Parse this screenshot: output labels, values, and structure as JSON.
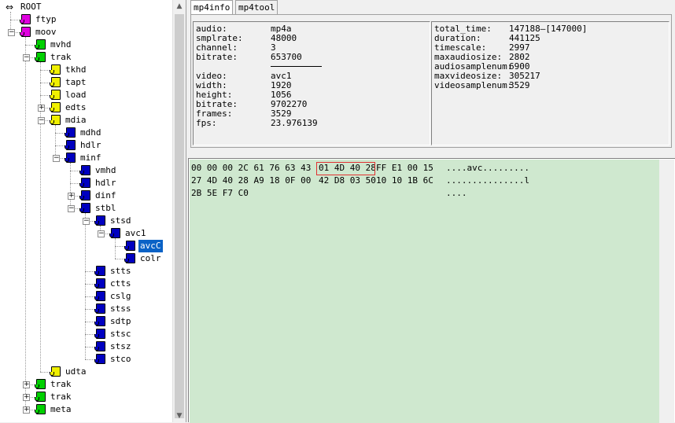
{
  "tree": {
    "nodes": [
      {
        "label": "ROOT",
        "depth": 0,
        "color": "root",
        "exp": ""
      },
      {
        "label": "ftyp",
        "depth": 1,
        "color": "#e000e0",
        "exp": ""
      },
      {
        "label": "moov",
        "depth": 1,
        "color": "#e000e0",
        "exp": "-"
      },
      {
        "label": "mvhd",
        "depth": 2,
        "color": "#00d000",
        "exp": ""
      },
      {
        "label": "trak",
        "depth": 2,
        "color": "#00d000",
        "exp": "-"
      },
      {
        "label": "tkhd",
        "depth": 3,
        "color": "#f0f000",
        "exp": ""
      },
      {
        "label": "tapt",
        "depth": 3,
        "color": "#f0f000",
        "exp": ""
      },
      {
        "label": "load",
        "depth": 3,
        "color": "#f0f000",
        "exp": ""
      },
      {
        "label": "edts",
        "depth": 3,
        "color": "#f0f000",
        "exp": "+"
      },
      {
        "label": "mdia",
        "depth": 3,
        "color": "#f0f000",
        "exp": "-"
      },
      {
        "label": "mdhd",
        "depth": 4,
        "color": "#0000c0",
        "exp": ""
      },
      {
        "label": "hdlr",
        "depth": 4,
        "color": "#0000c0",
        "exp": ""
      },
      {
        "label": "minf",
        "depth": 4,
        "color": "#0000c0",
        "exp": "-"
      },
      {
        "label": "vmhd",
        "depth": 5,
        "color": "#0000c0",
        "exp": ""
      },
      {
        "label": "hdlr",
        "depth": 5,
        "color": "#0000c0",
        "exp": ""
      },
      {
        "label": "dinf",
        "depth": 5,
        "color": "#0000c0",
        "exp": "+"
      },
      {
        "label": "stbl",
        "depth": 5,
        "color": "#0000c0",
        "exp": "-"
      },
      {
        "label": "stsd",
        "depth": 6,
        "color": "#0000c0",
        "exp": "-"
      },
      {
        "label": "avc1",
        "depth": 7,
        "color": "#0000c0",
        "exp": "-"
      },
      {
        "label": "avcC",
        "depth": 8,
        "color": "#0000c0",
        "exp": "",
        "selected": true
      },
      {
        "label": "colr",
        "depth": 8,
        "color": "#0000c0",
        "exp": ""
      },
      {
        "label": "stts",
        "depth": 6,
        "color": "#0000c0",
        "exp": ""
      },
      {
        "label": "ctts",
        "depth": 6,
        "color": "#0000c0",
        "exp": ""
      },
      {
        "label": "cslg",
        "depth": 6,
        "color": "#0000c0",
        "exp": ""
      },
      {
        "label": "stss",
        "depth": 6,
        "color": "#0000c0",
        "exp": ""
      },
      {
        "label": "sdtp",
        "depth": 6,
        "color": "#0000c0",
        "exp": ""
      },
      {
        "label": "stsc",
        "depth": 6,
        "color": "#0000c0",
        "exp": ""
      },
      {
        "label": "stsz",
        "depth": 6,
        "color": "#0000c0",
        "exp": ""
      },
      {
        "label": "stco",
        "depth": 6,
        "color": "#0000c0",
        "exp": ""
      },
      {
        "label": "udta",
        "depth": 3,
        "color": "#f0f000",
        "exp": ""
      },
      {
        "label": "trak",
        "depth": 2,
        "color": "#00d000",
        "exp": "+"
      },
      {
        "label": "trak",
        "depth": 2,
        "color": "#00d000",
        "exp": "+"
      },
      {
        "label": "meta",
        "depth": 2,
        "color": "#00d000",
        "exp": "+"
      }
    ]
  },
  "tabs": [
    {
      "label": "mp4info",
      "active": true
    },
    {
      "label": "mp4tool",
      "active": false
    }
  ],
  "info": {
    "left": [
      {
        "key": "audio:",
        "value": "mp4a"
      },
      {
        "key": "smplrate:",
        "value": "48000"
      },
      {
        "key": "channel:",
        "value": "3"
      },
      {
        "key": "bitrate:",
        "value": "653700"
      },
      {
        "key": "video:",
        "value": "avc1"
      },
      {
        "key": "width:",
        "value": "1920"
      },
      {
        "key": "height:",
        "value": "1056"
      },
      {
        "key": "bitrate:",
        "value": "9702270"
      },
      {
        "key": "frames:",
        "value": "3529"
      },
      {
        "key": "fps:",
        "value": "23.976139"
      }
    ],
    "right": [
      {
        "key": "total_time:",
        "value": "147188—[147000]"
      },
      {
        "key": "duration:",
        "value": "441125"
      },
      {
        "key": "timescale:",
        "value": "2997"
      },
      {
        "key": "maxaudiosize:",
        "value": "2802"
      },
      {
        "key": "audiosamplenum:",
        "value": "6900"
      },
      {
        "key": "maxvideosize:",
        "value": "305217"
      },
      {
        "key": "videosamplenum:",
        "value": "3529"
      }
    ]
  },
  "hex": {
    "rows": [
      {
        "left": "00 00 00 2C 61 76 63 43",
        "mid": "01 4D 40 28",
        "right": "FF E1 00 15",
        "ascii": "....avc........."
      },
      {
        "left": "27 4D 40 28 A9 18 0F 00",
        "mid": "42 D8 03 50",
        "right": "10 10 1B 6C",
        "ascii": "...............l"
      },
      {
        "left": "2B 5E F7 C0",
        "mid": "",
        "right": "",
        "ascii": "...."
      }
    ],
    "highlight_color": "#e03030",
    "background": "#cfe8cf"
  }
}
